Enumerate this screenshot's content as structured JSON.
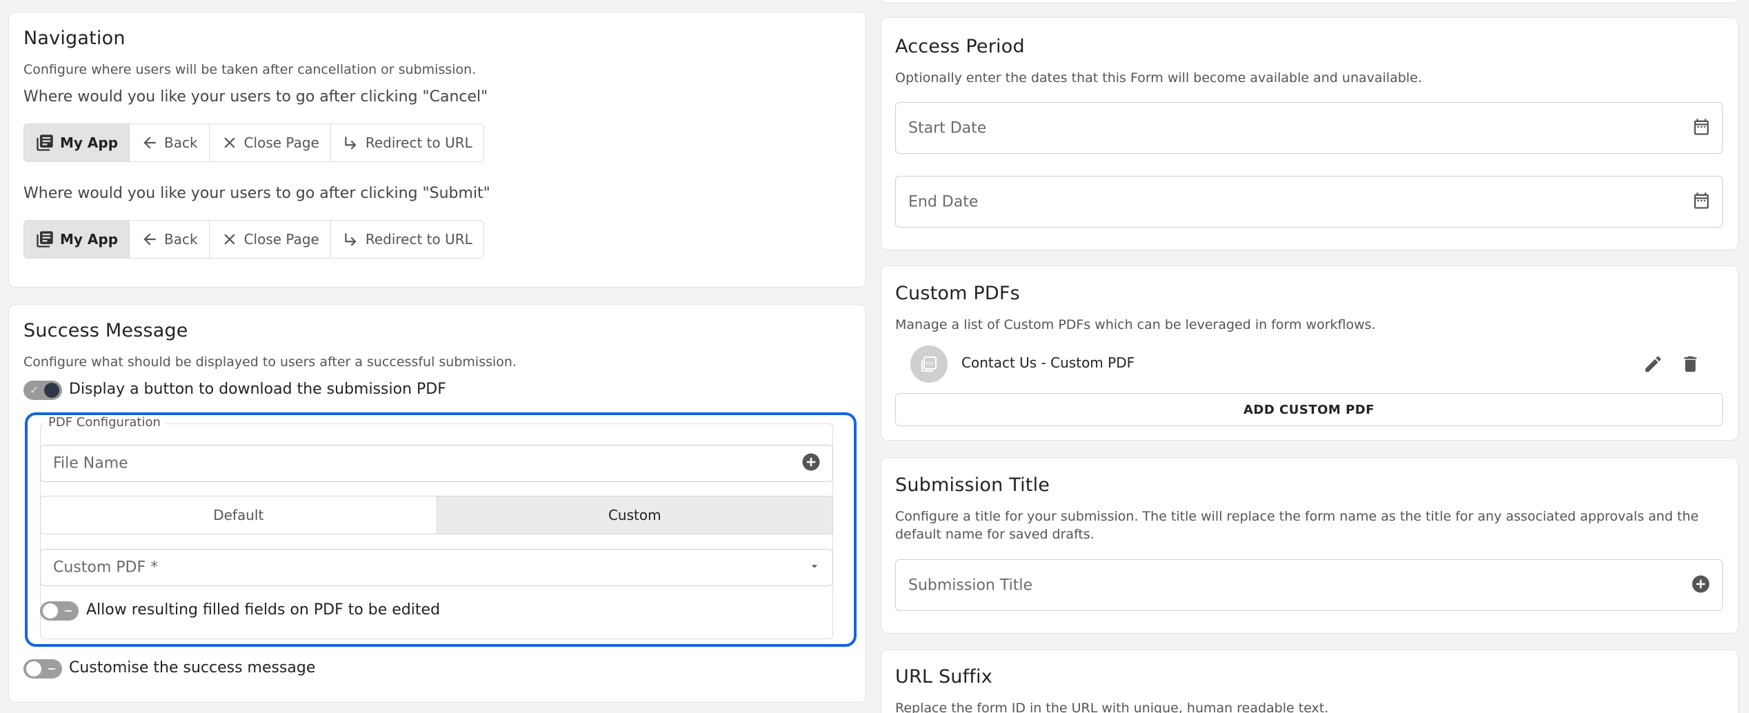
{
  "navigation": {
    "title": "Navigation",
    "description": "Configure where users will be taken after cancellation or submission.",
    "cancel_question": "Where would you like your users to go after clicking \"Cancel\"",
    "submit_question": "Where would you like your users to go after clicking \"Submit\"",
    "options": [
      {
        "label": "My App",
        "icon": "library-icon",
        "selected": true
      },
      {
        "label": "Back",
        "icon": "arrow-left-icon"
      },
      {
        "label": "Close Page",
        "icon": "close-icon"
      },
      {
        "label": "Redirect to URL",
        "icon": "subdirectory-arrow-right-icon"
      }
    ]
  },
  "success_message": {
    "title": "Success Message",
    "description": "Configure what should be displayed to users after a successful submission.",
    "download_toggle_label": "Display a button to download the submission PDF",
    "download_toggle_on": true,
    "pdf_config": {
      "legend": "PDF Configuration",
      "file_name_placeholder": "File Name",
      "tabs": [
        "Default",
        "Custom"
      ],
      "selected_tab": "Custom",
      "custom_pdf_placeholder": "Custom PDF *",
      "allow_edit_label": "Allow resulting filled fields on PDF to be edited",
      "allow_edit_on": false
    },
    "customise_label": "Customise the success message",
    "customise_on": false
  },
  "access_period": {
    "title": "Access Period",
    "description": "Optionally enter the dates that this Form will become available and unavailable.",
    "start_placeholder": "Start Date",
    "end_placeholder": "End Date"
  },
  "custom_pdfs": {
    "title": "Custom PDFs",
    "description": "Manage a list of Custom PDFs which can be leveraged in form workflows.",
    "items": [
      {
        "name": "Contact Us - Custom PDF",
        "icon_text": "PDF"
      }
    ],
    "add_label": "ADD CUSTOM PDF"
  },
  "submission_title": {
    "title": "Submission Title",
    "description_line1": "Configure a title for your submission. The title will replace the form name as the title for any associated approvals and the",
    "description_line2": "default name for saved drafts.",
    "placeholder": "Submission Title"
  },
  "url_suffix": {
    "title": "URL Suffix",
    "description": "Replace the form ID in the URL with unique, human readable text."
  },
  "colors": {
    "accent_frame": "#1565e0",
    "toggle_on_knob": "#2e3748"
  }
}
